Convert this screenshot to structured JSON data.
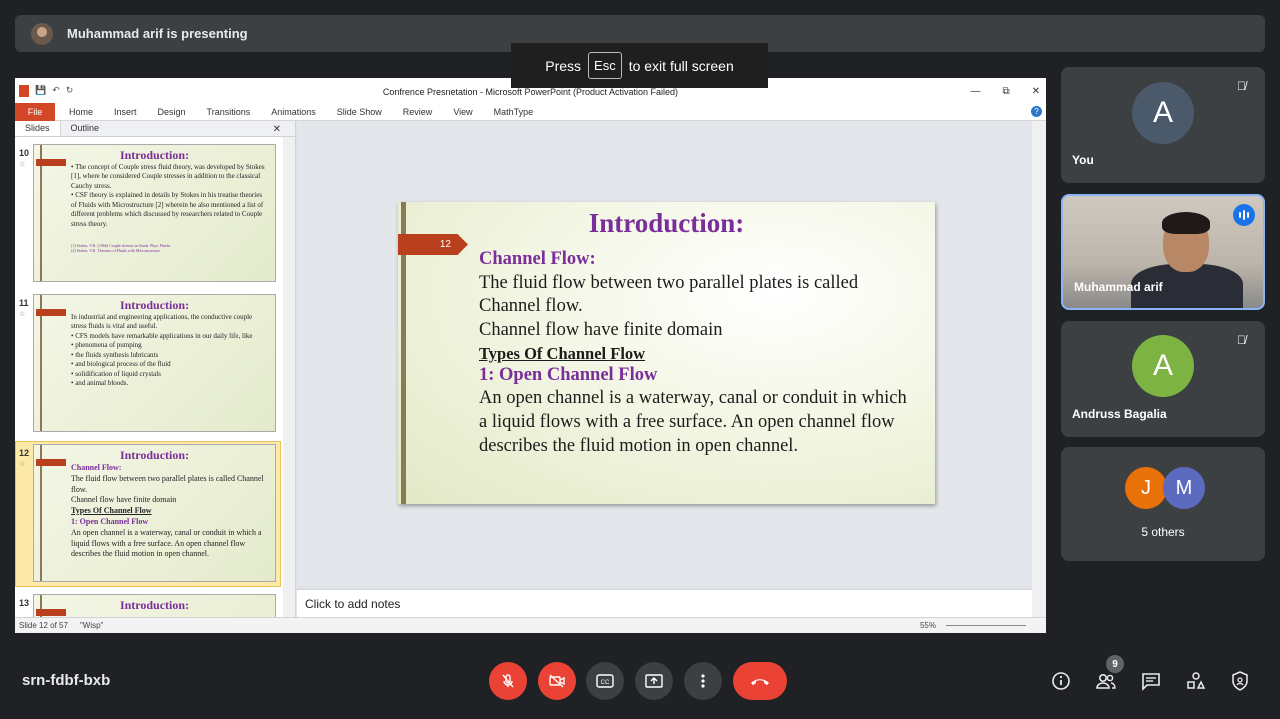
{
  "presenting": {
    "text": "Muhammad arif is presenting"
  },
  "esc_banner": {
    "press": "Press",
    "key": "Esc",
    "suffix": "to exit full screen"
  },
  "ppt": {
    "window_title": "Confrence Presnetation  -  Microsoft PowerPoint (Product Activation Failed)",
    "ribbon_tabs": [
      "File",
      "Home",
      "Insert",
      "Design",
      "Transitions",
      "Animations",
      "Slide Show",
      "Review",
      "View",
      "MathType"
    ],
    "panel_tabs": [
      "Slides",
      "Outline"
    ],
    "thumbnails": [
      {
        "num": "10",
        "title": "Introduction:",
        "lines": [
          "•  The concept of Couple stress fluid theory, was developed by Stokes [1], where he considered Couple stresses in addition to the classical Cauchy stress.",
          "•  CSF theory is explained in details by Stokes in his treatise theories of Fluids with Microstructure [2] wherein he also mentioned a list of different problems which discussed by researchers related to Couple stress theory.",
          "[1] Stokes, V.K. (1966) Couple stresses in fluids. Phys. Fluids.",
          "[2] Stokes, V.K. Theories of Fluids with Microstructure."
        ]
      },
      {
        "num": "11",
        "title": "Introduction:",
        "lines": [
          "In industrial and engineering applications, the conductive couple stress fluids is vital and useful.",
          "•  CFS models have remarkable applications in our daily life, like",
          "•  phenomena of pumping",
          "•  the fluids synthesis lubricants",
          "•  and biological process of the fluid",
          "•  solidification of liquid crystals",
          "•  and animal bloods."
        ]
      },
      {
        "num": "12",
        "title": "Introduction:",
        "heading1": "Channel Flow:",
        "lines_a": [
          "The fluid flow between two parallel plates is called Channel flow.",
          "Channel flow have finite domain"
        ],
        "heading_ul": "Types Of Channel Flow",
        "heading2": "1: Open Channel Flow",
        "lines_b": [
          "An open channel is a waterway, canal or conduit in which a liquid flows with a free surface. An open channel flow describes the fluid motion in open channel."
        ]
      },
      {
        "num": "13",
        "title": "Introduction:"
      }
    ],
    "slide": {
      "number": "12",
      "title": "Introduction:",
      "channel_heading": "Channel Flow:",
      "line1": "The fluid flow between two parallel plates is called Channel flow.",
      "line2": "Channel flow have finite domain",
      "types_heading": "Types Of Channel Flow",
      "open_heading": "1: Open Channel Flow",
      "line3": "An open channel is a waterway, canal or conduit in which a liquid flows with a free surface. An open channel flow describes the fluid motion in open channel."
    },
    "notes_placeholder": "Click to add notes",
    "status": {
      "slide": "Slide 12 of 57",
      "theme": "\"Wisp\"",
      "zoom": "55%"
    }
  },
  "participants": [
    {
      "name": "You",
      "initial": "A",
      "color": "#4a5a6a",
      "muted": true
    },
    {
      "name": "Muhammad arif",
      "video": true,
      "speaking": true
    },
    {
      "name": "Andruss Bagalia",
      "initial": "A",
      "color": "#7cb342",
      "muted": true
    },
    {
      "name": "5 others",
      "initials": [
        "J",
        "M"
      ],
      "colors": [
        "#e8710a",
        "#5c6bc0"
      ]
    }
  ],
  "bottom": {
    "meeting_code": "srn-fdbf-bxb",
    "participant_count": "9",
    "icons": [
      "mic-off-icon",
      "camera-off-icon",
      "captions-icon",
      "present-icon",
      "more-icon",
      "end-call-icon",
      "info-icon",
      "people-icon",
      "chat-icon",
      "activities-icon",
      "host-controls-icon"
    ]
  }
}
